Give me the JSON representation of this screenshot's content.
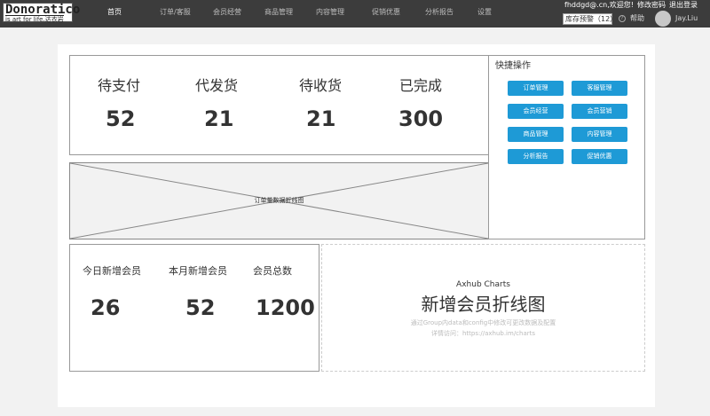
{
  "header": {
    "logo_main": "Donoratico",
    "logo_sub": "is art for life.达衣岩",
    "nav": [
      {
        "label": "首页",
        "active": true
      },
      {
        "label": "订单/客服",
        "active": false
      },
      {
        "label": "会员经营",
        "active": false
      },
      {
        "label": "商品管理",
        "active": false
      },
      {
        "label": "内容管理",
        "active": false
      },
      {
        "label": "促销优惠",
        "active": false
      },
      {
        "label": "分析报告",
        "active": false
      },
      {
        "label": "设置",
        "active": false
      }
    ],
    "welcome": "fhddgd@.cn,欢迎您!",
    "change_password": "修改密码",
    "logout": "退出登录",
    "stock_alert": "库存预警（12）",
    "help_label": "帮助",
    "username": "Jay.Liu"
  },
  "orders": {
    "stats": [
      {
        "label": "待支付",
        "value": "52"
      },
      {
        "label": "代发货",
        "value": "21"
      },
      {
        "label": "待收货",
        "value": "21"
      },
      {
        "label": "已完成",
        "value": "300"
      }
    ]
  },
  "order_chart": {
    "placeholder_label": "订单量数据折线图"
  },
  "quick_actions": {
    "title": "快捷操作",
    "buttons": [
      "订单管理",
      "客服管理",
      "会员经营",
      "会员营销",
      "商品管理",
      "内容管理",
      "分析报告",
      "促销优惠"
    ],
    "button_color": "#1e9ad6"
  },
  "members": {
    "stats": [
      {
        "label": "今日新增会员",
        "value": "26"
      },
      {
        "label": "本月新增会员",
        "value": "52"
      },
      {
        "label": "会员总数",
        "value": "1200"
      }
    ]
  },
  "axhub": {
    "name": "Axhub Charts",
    "title": "新增会员折线图",
    "desc": "通过Group内data和config中修改可更改数据及配置",
    "link": "详情访问：https://axhub.im/charts"
  },
  "colors": {
    "topbar": "#3c3c3c",
    "accent": "#1e9ad6"
  }
}
